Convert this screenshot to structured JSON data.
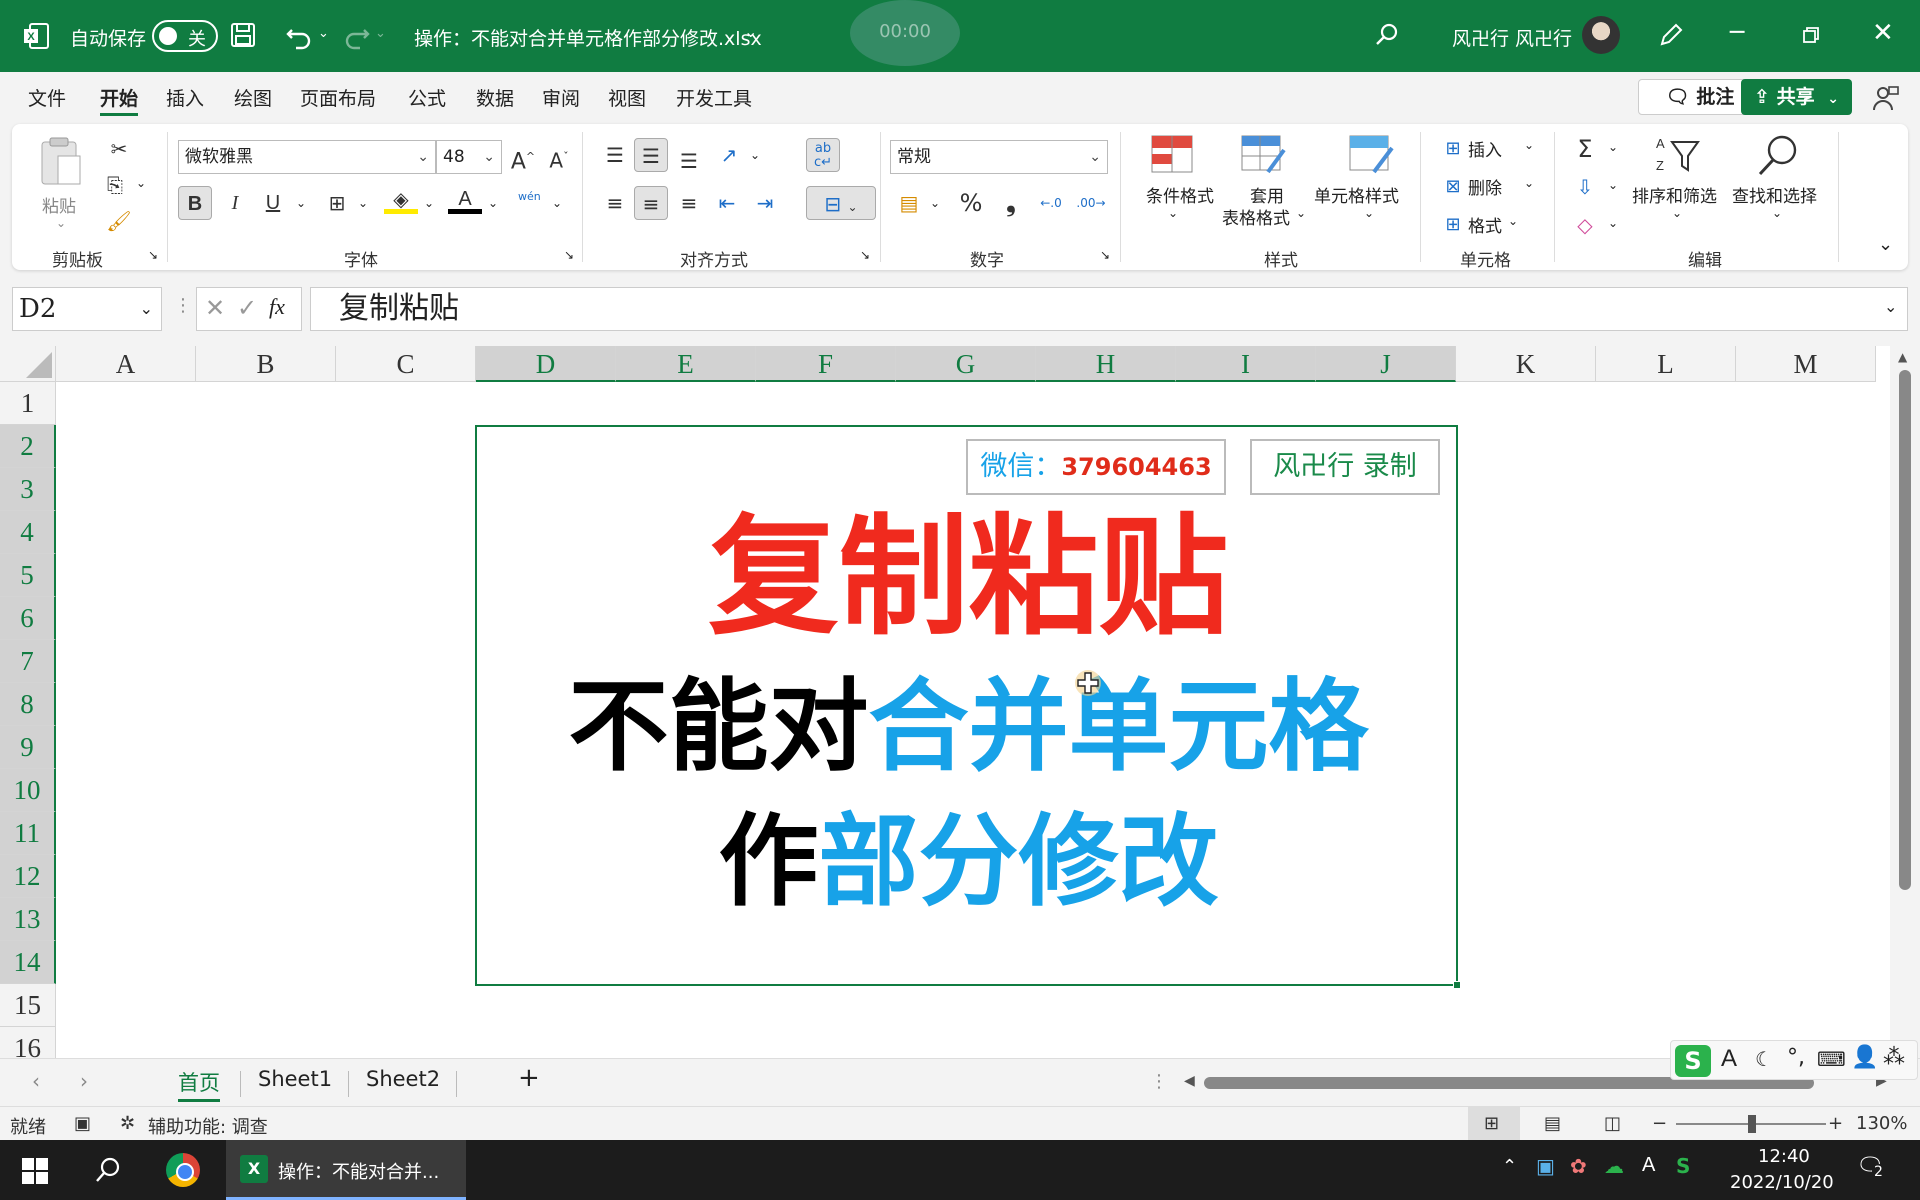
{
  "titlebar": {
    "autosave_label": "自动保存",
    "autosave_state": "关",
    "filename": "操作：不能对合并单元格作部分修改.xlsx",
    "timer": "00:00",
    "user_name": "风卍行 风卍行"
  },
  "menu": {
    "items": [
      "文件",
      "开始",
      "插入",
      "绘图",
      "页面布局",
      "公式",
      "数据",
      "审阅",
      "视图",
      "开发工具"
    ],
    "active": "开始",
    "comment_label": "批注",
    "share_label": "共享"
  },
  "ribbon": {
    "clipboard": {
      "paste": "粘贴",
      "label": "剪贴板"
    },
    "font": {
      "name": "微软雅黑",
      "size": "48",
      "label": "字体",
      "bold": "B",
      "italic": "I",
      "underline": "U",
      "phonetic": "wén"
    },
    "alignment": {
      "label": "对齐方式"
    },
    "number": {
      "format": "常规",
      "label": "数字",
      "percent": "%",
      "comma": "❟"
    },
    "styles": {
      "conditional": "条件格式",
      "table_line1": "套用",
      "table_line2": "表格格式",
      "cell_styles": "单元格样式",
      "label": "样式"
    },
    "cells": {
      "insert": "插入",
      "delete": "删除",
      "format": "格式",
      "label": "单元格"
    },
    "editing": {
      "sort_filter": "排序和筛选",
      "find_select": "查找和选择",
      "label": "编辑",
      "sum": "Σ"
    }
  },
  "formula_bar": {
    "name_box": "D2",
    "fx": "fx",
    "content": "复制粘贴"
  },
  "grid": {
    "columns": [
      "A",
      "B",
      "C",
      "D",
      "E",
      "F",
      "G",
      "H",
      "I",
      "J",
      "K",
      "L",
      "M"
    ],
    "rows": [
      "1",
      "2",
      "3",
      "4",
      "5",
      "6",
      "7",
      "8",
      "9",
      "10",
      "11",
      "12",
      "13",
      "14",
      "15",
      "16"
    ],
    "badge_wechat_label": "微信：",
    "badge_wechat_number": "379604463",
    "badge_recorder": "风卍行 录制",
    "title_line1": "复制粘贴",
    "title_line2_black": "不能对",
    "title_line2_blue": "合并单元格",
    "title_line3_black": "作",
    "title_line3_blue": "部分修改"
  },
  "sheets": {
    "tabs": [
      "首页",
      "Sheet1",
      "Sheet2"
    ],
    "active": "首页",
    "add": "+"
  },
  "status": {
    "ready": "就绪",
    "accessibility": "辅助功能: 调查",
    "zoom": "130%"
  },
  "taskbar": {
    "excel_task": "操作：不能对合并...",
    "time": "12:40",
    "date": "2022/10/20",
    "notification_count": "2"
  },
  "ime": {
    "logo": "S",
    "letter": "A"
  },
  "colors": {
    "excel_green": "#107c41",
    "title_red": "#f02a1e",
    "title_blue": "#17a2e8",
    "wechat_number_red": "#e02c1a",
    "recorder_green": "#1a8a4a"
  }
}
